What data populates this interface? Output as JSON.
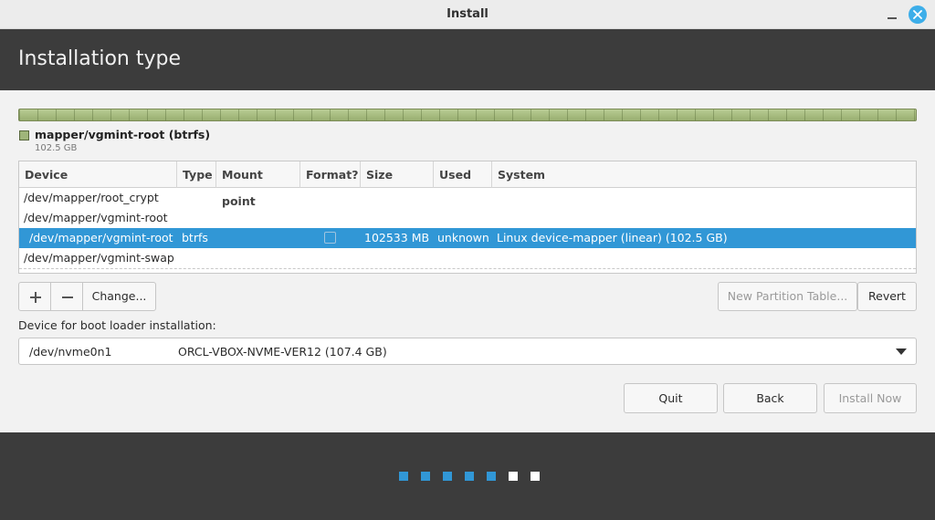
{
  "window": {
    "title": "Install"
  },
  "header": {
    "title": "Installation type"
  },
  "partition_legend": {
    "name": "mapper/vgmint-root (btrfs)",
    "size": "102.5 GB",
    "color": "#9fb57a"
  },
  "table": {
    "columns": [
      "Device",
      "Type",
      "Mount point",
      "Format?",
      "Size",
      "Used",
      "System"
    ],
    "rows": [
      {
        "device": "/dev/mapper/root_crypt",
        "type": "",
        "mount": "",
        "size": "",
        "used": "",
        "system": ""
      },
      {
        "device": "/dev/mapper/vgmint-root",
        "type": "",
        "mount": "",
        "size": "",
        "used": "",
        "system": ""
      },
      {
        "device": "/dev/mapper/vgmint-root",
        "type": "btrfs",
        "mount": "",
        "size": "102533 MB",
        "used": "unknown",
        "system": "Linux device-mapper (linear) (102.5 GB)",
        "selected": true
      },
      {
        "device": "/dev/mapper/vgmint-swap",
        "type": "",
        "mount": "",
        "size": "",
        "used": "",
        "system": ""
      }
    ]
  },
  "buttons": {
    "change": "Change...",
    "new_partition_table": "New Partition Table...",
    "revert": "Revert",
    "quit": "Quit",
    "back": "Back",
    "install_now": "Install Now"
  },
  "boot_loader": {
    "label": "Device for boot loader installation:",
    "device": "/dev/nvme0n1",
    "description": "ORCL-VBOX-NVME-VER12 (107.4 GB)"
  },
  "progress": {
    "total_steps": 7,
    "completed_steps": 5,
    "active_color": "#3197d6",
    "inactive_color": "#ffffff"
  },
  "colors": {
    "accent": "#3197d6",
    "header_bg": "#3c3c3c"
  }
}
